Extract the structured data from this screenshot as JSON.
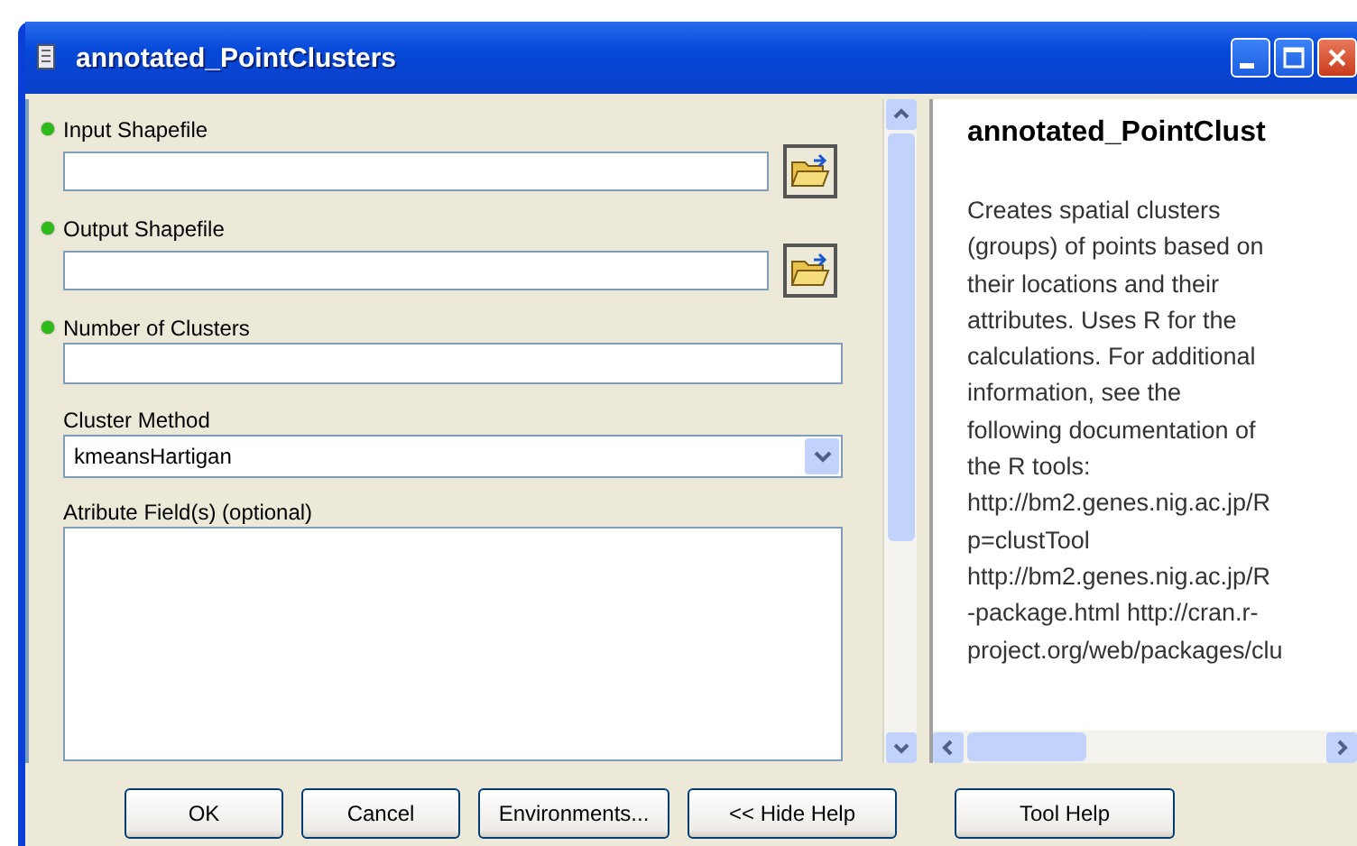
{
  "window": {
    "title": "annotated_PointClusters"
  },
  "parameters": [
    {
      "label": "Input Shapefile",
      "required": true,
      "kind": "file"
    },
    {
      "label": "Output Shapefile",
      "required": true,
      "kind": "file"
    },
    {
      "label": "Number of Clusters",
      "required": true,
      "kind": "text"
    },
    {
      "label": "Cluster Method",
      "required": false,
      "kind": "dropdown",
      "value": "kmeansHartigan"
    },
    {
      "label": "Atribute Field(s) (optional)",
      "required": false,
      "kind": "list"
    }
  ],
  "help": {
    "heading": "annotated_PointClust",
    "lines": [
      "Creates spatial clusters",
      "(groups) of points based on",
      "their locations and their",
      "attributes. Uses R for the",
      "calculations. For additional",
      "information, see the",
      "following documentation of",
      "the R tools:",
      "http://bm2.genes.nig.ac.jp/R",
      "p=clustTool",
      "http://bm2.genes.nig.ac.jp/R",
      "-package.html http://cran.r-",
      "project.org/web/packages/clu"
    ]
  },
  "buttons": [
    "OK",
    "Cancel",
    "Environments...",
    "<< Hide Help",
    "Tool Help"
  ]
}
